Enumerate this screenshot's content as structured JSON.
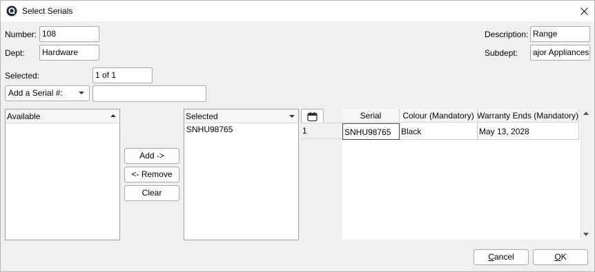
{
  "window": {
    "title": "Select Serials",
    "logo_icon": "q-logo-icon",
    "close_icon": "close-icon"
  },
  "header": {
    "number_label": "Number:",
    "number_value": "108",
    "dept_label": "Dept:",
    "dept_value": "Hardware",
    "description_label": "Description:",
    "description_value": "Range",
    "subdept_label": "Subdept:",
    "subdept_value": "ajor Appliances"
  },
  "selection": {
    "selected_label": "Selected:",
    "selected_value": "1 of 1",
    "add_serial_dropdown": "Add a Serial #:",
    "add_serial_input": ""
  },
  "available_list": {
    "header": "Available",
    "items": []
  },
  "transfer_buttons": {
    "add": "Add ->",
    "remove": "<- Remove",
    "clear": "Clear"
  },
  "selected_list": {
    "header": "Selected",
    "items": [
      "SNHU98765"
    ]
  },
  "grid": {
    "calendar_icon": "calendar-icon",
    "columns": [
      "Serial",
      "Colour (Mandatory)",
      "Warranty Ends (Mandatory)"
    ],
    "rows": [
      {
        "num": "1",
        "cells": [
          "SNHU98765",
          "Black",
          "May 13, 2028"
        ]
      }
    ]
  },
  "footer": {
    "cancel_label": "Cancel",
    "cancel_mnemonic": "C",
    "cancel_rest": "ancel",
    "ok_label": "OK",
    "ok_mnemonic": "O",
    "ok_rest": "K"
  }
}
